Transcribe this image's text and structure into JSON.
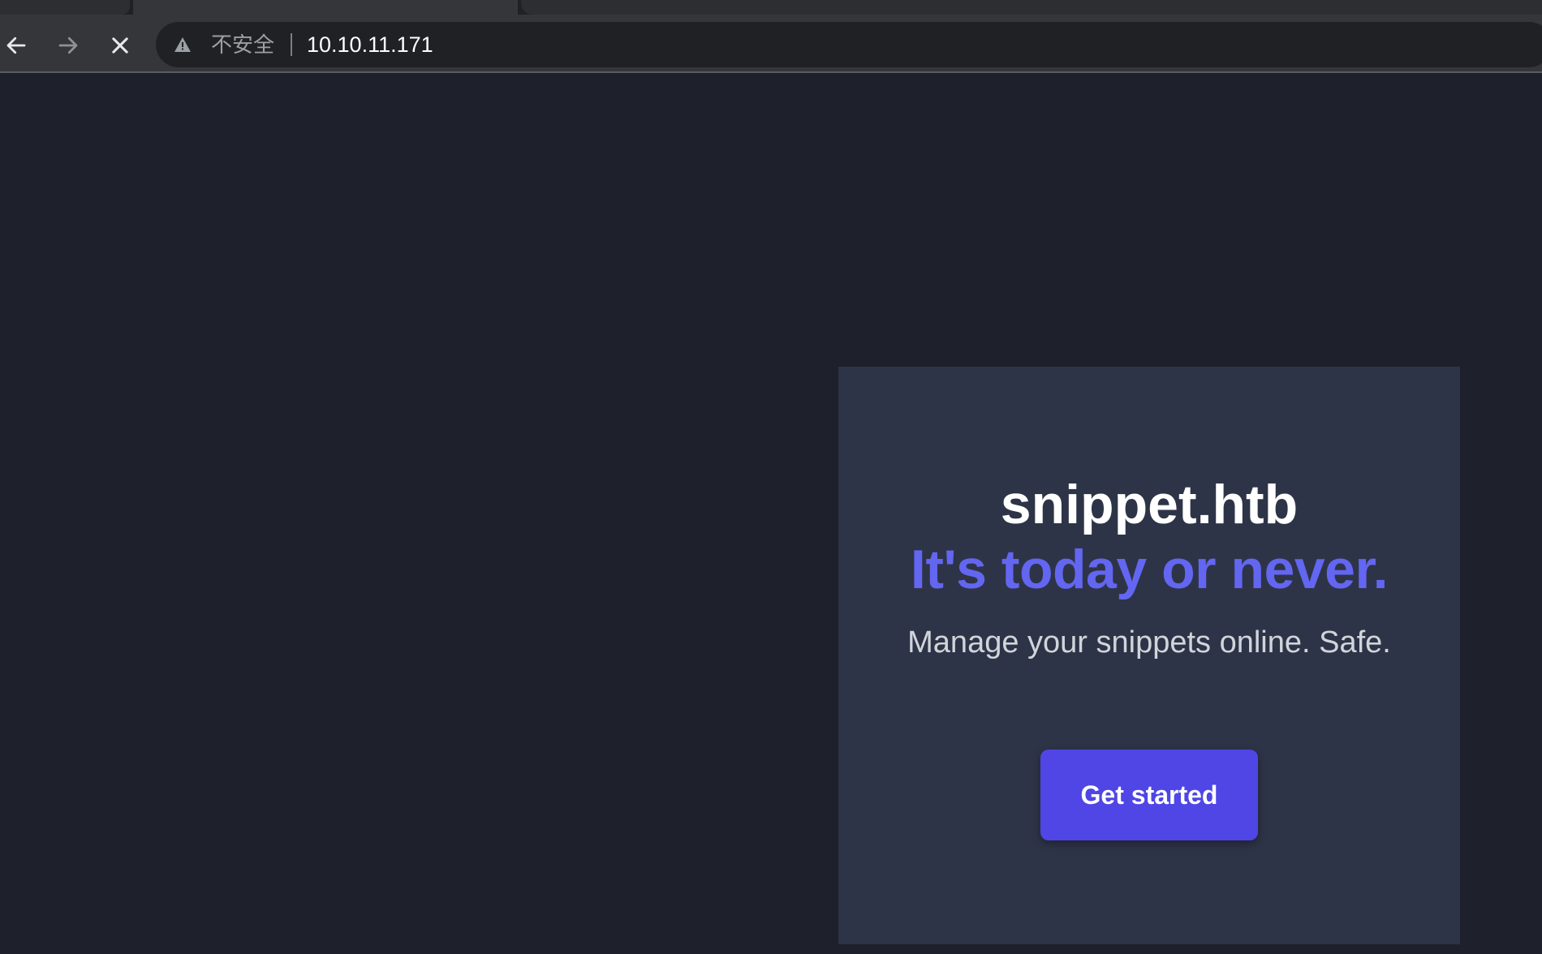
{
  "browser": {
    "security_label": "不安全",
    "url": "10.10.11.171",
    "icons": {
      "back": "arrow-left-icon",
      "forward": "arrow-right-icon",
      "stop": "close-icon",
      "security": "warning-icon"
    }
  },
  "hero": {
    "brand": "snippet.htb",
    "tagline": "It's today or never.",
    "subtext": "Manage your snippets online. Safe.",
    "cta_label": "Get started"
  },
  "colors": {
    "page_bg": "#1e202b",
    "card_bg": "#2e3447",
    "accent": "#6366f1",
    "button": "#4f46e5"
  }
}
